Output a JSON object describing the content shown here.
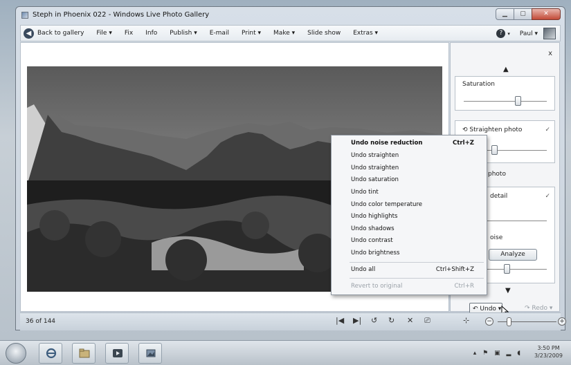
{
  "window": {
    "title": "Steph in Phoenix 022 - Windows Live Photo Gallery"
  },
  "menubar": {
    "back": "Back to gallery",
    "items": [
      "File ▾",
      "Fix",
      "Info",
      "Publish ▾",
      "E-mail",
      "Print ▾",
      "Make ▾",
      "Slide show",
      "Extras ▾"
    ],
    "help": "?",
    "user": "Paul ▾"
  },
  "panel": {
    "saturation_label": "Saturation",
    "straighten_label": "Straighten photo",
    "crop_partial": "photo",
    "detail_partial": "detail",
    "noise_partial": "oise",
    "analyze_label": "Analyze",
    "undo_label": "Undo ▾",
    "redo_label": "Redo ▾"
  },
  "undo_menu": {
    "items": [
      {
        "label": "Undo noise reduction",
        "shortcut": "Ctrl+Z"
      },
      {
        "label": "Undo straighten",
        "shortcut": ""
      },
      {
        "label": "Undo straighten",
        "shortcut": ""
      },
      {
        "label": "Undo saturation",
        "shortcut": ""
      },
      {
        "label": "Undo tint",
        "shortcut": ""
      },
      {
        "label": "Undo color temperature",
        "shortcut": ""
      },
      {
        "label": "Undo highlights",
        "shortcut": ""
      },
      {
        "label": "Undo shadows",
        "shortcut": ""
      },
      {
        "label": "Undo contrast",
        "shortcut": ""
      },
      {
        "label": "Undo brightness",
        "shortcut": ""
      }
    ],
    "undo_all": {
      "label": "Undo all",
      "shortcut": "Ctrl+Shift+Z"
    },
    "revert": {
      "label": "Revert to original",
      "shortcut": "Ctrl+R"
    }
  },
  "status": {
    "count": "36 of 144"
  },
  "clock": {
    "time": "3:50 PM",
    "date": "3/23/2009"
  }
}
